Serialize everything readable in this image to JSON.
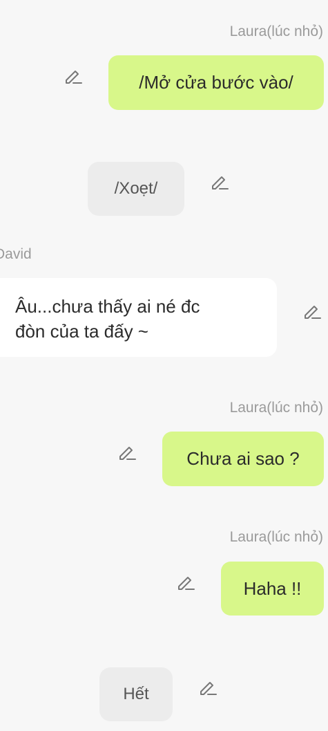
{
  "messages": [
    {
      "kind": "user",
      "speaker": "Laura(lúc nhỏ)",
      "text": "/Mở cửa bước vào/"
    },
    {
      "kind": "narration",
      "text": "/Xoẹt/"
    },
    {
      "kind": "character",
      "speaker": "David",
      "text": "Âu...chưa thấy ai né đc\nđòn của ta đấy ~"
    },
    {
      "kind": "user",
      "speaker": "Laura(lúc nhỏ)",
      "text": "Chưa ai sao ?"
    },
    {
      "kind": "user",
      "speaker": "Laura(lúc nhỏ)",
      "text": "Haha !!"
    },
    {
      "kind": "narration",
      "text": "Hết"
    }
  ],
  "icons": {
    "edit": "pencil-edit-icon"
  },
  "colors": {
    "background": "#f7f7f7",
    "user_bubble": "#d8f78a",
    "character_bubble": "#ffffff",
    "narration_bubble": "#ececec",
    "speaker_name": "#9a9a9a",
    "icon": "#777777"
  }
}
